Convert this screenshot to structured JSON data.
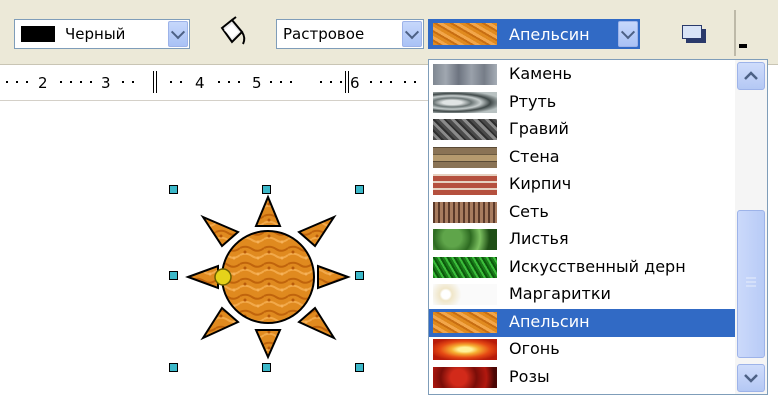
{
  "toolbar": {
    "line_color": {
      "label": "Черный",
      "color": "#000000"
    },
    "fill_style": {
      "label": "Растровое"
    },
    "bitmap": {
      "label": "Апельсин"
    }
  },
  "ruler": {
    "numbers": [
      "2",
      "3",
      "4",
      "5",
      "6"
    ]
  },
  "bitmap_list": {
    "items": [
      {
        "label": "Камень",
        "swatch": "stone"
      },
      {
        "label": "Ртуть",
        "swatch": "mercury"
      },
      {
        "label": "Гравий",
        "swatch": "gravel"
      },
      {
        "label": "Стена",
        "swatch": "wall"
      },
      {
        "label": "Кирпич",
        "swatch": "brick"
      },
      {
        "label": "Сеть",
        "swatch": "net"
      },
      {
        "label": "Листья",
        "swatch": "leaves"
      },
      {
        "label": "Искусственный дерн",
        "swatch": "turf"
      },
      {
        "label": "Маргаритки",
        "swatch": "daisies"
      },
      {
        "label": "Апельсин",
        "swatch": "orange",
        "selected": true
      },
      {
        "label": "Огонь",
        "swatch": "fire"
      },
      {
        "label": "Розы",
        "swatch": "roses"
      }
    ]
  },
  "colors": {
    "selection": "#316ac5",
    "sun_fill": "#e08a1f",
    "handle": "#3cb8c9"
  }
}
